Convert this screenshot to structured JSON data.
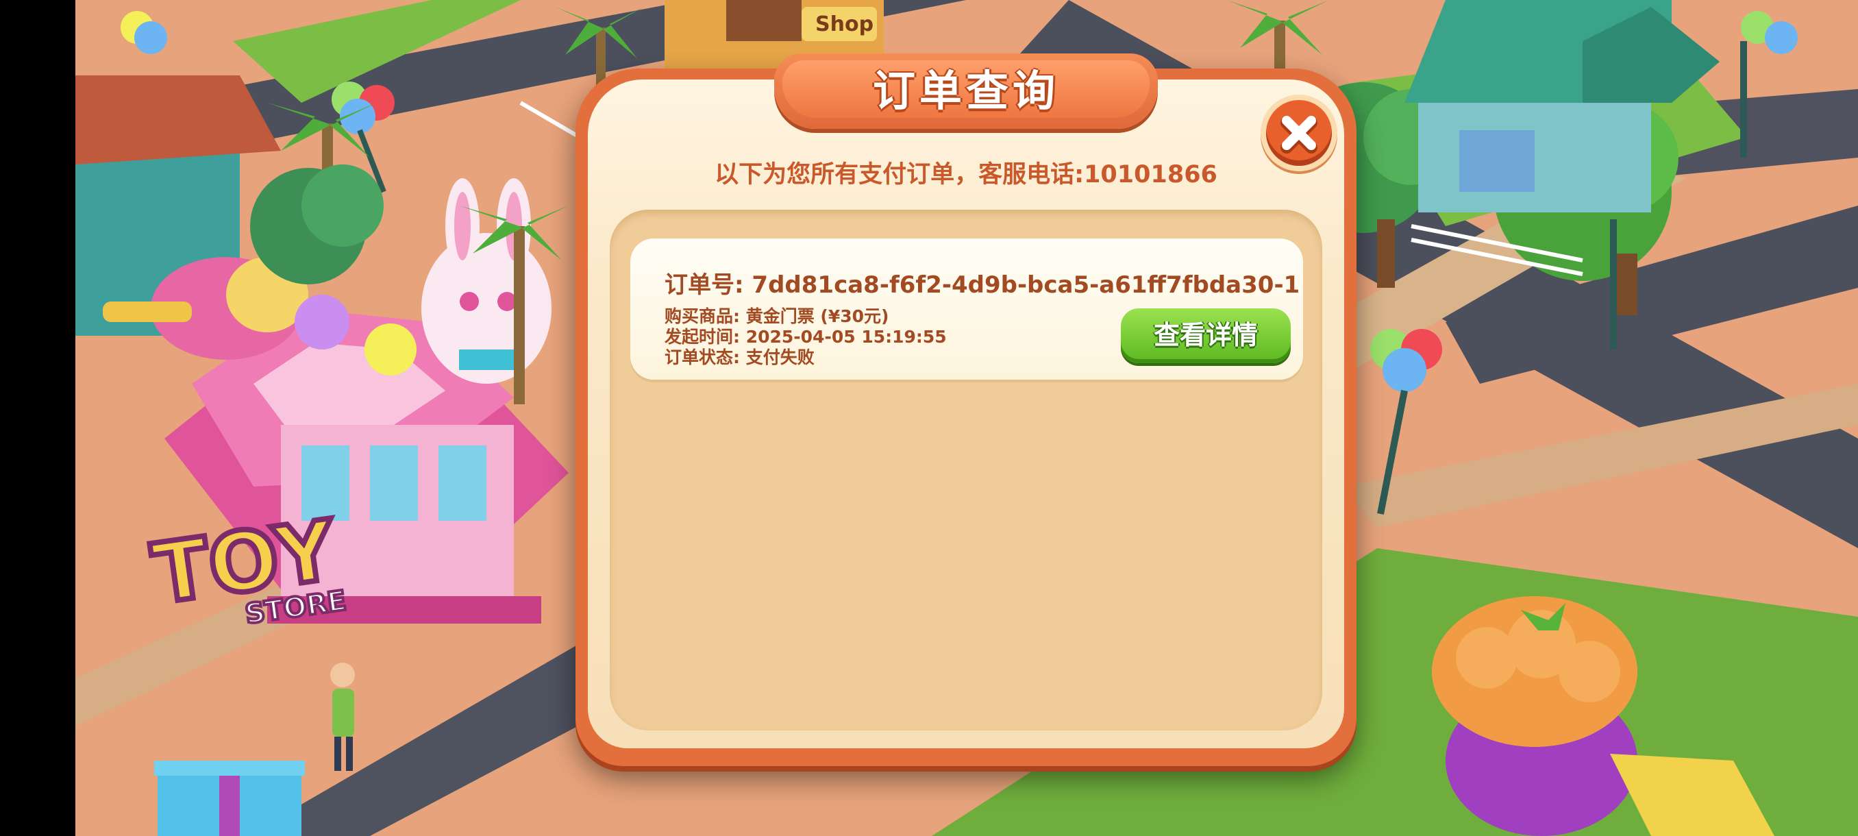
{
  "dialog": {
    "title": "订单查询",
    "subtitle": "以下为您所有支付订单，客服电话:10101866",
    "close_icon": "close-icon"
  },
  "orders": [
    {
      "order_id_line": "订单号: 7dd81ca8-f6f2-4d9b-bca5-a61ff7fbda30-1",
      "item_line": "购买商品: 黄金门票 (¥30元)",
      "time_line": "发起时间: 2025-04-05 15:19:55",
      "status_line": "订单状态: 支付失败",
      "details_button_label": "查看详情"
    }
  ],
  "scene": {
    "store_sign": "TOY",
    "store_sign_sub": "STORE",
    "shop_sign": "Shop"
  },
  "colors": {
    "dialog_border": "#e3703c",
    "dialog_face": "#fbe9c9",
    "text_brown": "#a24b23",
    "accent_green": "#5ab820"
  }
}
